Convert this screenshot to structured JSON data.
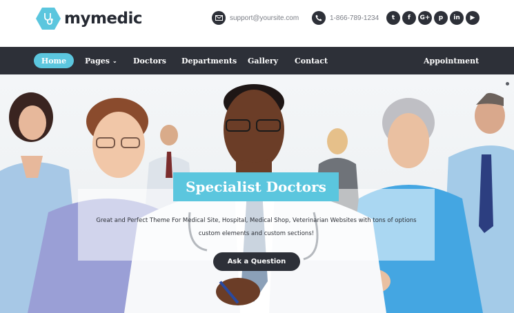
{
  "brand": {
    "name": "mymedic",
    "accent": "#5bc6de",
    "dark": "#2d3038"
  },
  "header": {
    "email": "support@yoursite.com",
    "phone": "1-866-789-1234",
    "social": [
      {
        "name": "twitter-icon",
        "glyph": "t"
      },
      {
        "name": "facebook-icon",
        "glyph": "f"
      },
      {
        "name": "google-plus-icon",
        "glyph": "G+"
      },
      {
        "name": "pinterest-icon",
        "glyph": "p"
      },
      {
        "name": "linkedin-icon",
        "glyph": "in"
      },
      {
        "name": "youtube-icon",
        "glyph": "▶"
      }
    ]
  },
  "nav": {
    "items": [
      "Home",
      "Pages",
      "Doctors",
      "Departments",
      "Gallery",
      "Contact"
    ],
    "appointment": "Appointment"
  },
  "hero": {
    "title": "Specialist Doctors",
    "line1": "Great and Perfect Theme For Medical Site, Hospital, Medical Shop, Veterinarian Websites with tons of options",
    "line2": "custom elements and custom sections!",
    "button": "Ask a Question"
  }
}
